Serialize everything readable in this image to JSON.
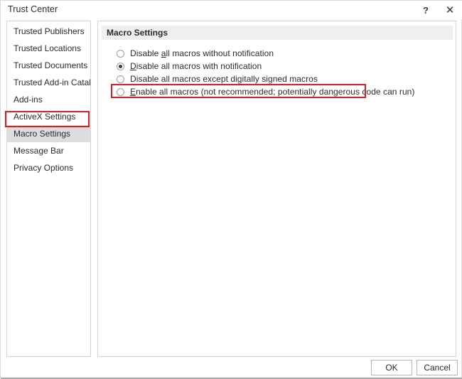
{
  "window": {
    "title": "Trust Center",
    "help_icon": "question-mark-icon",
    "help_label": "?",
    "close_icon": "close-icon",
    "close_label": "✕"
  },
  "sidebar": {
    "items": [
      {
        "label": "Trusted Publishers",
        "selected": false
      },
      {
        "label": "Trusted Locations",
        "selected": false
      },
      {
        "label": "Trusted Documents",
        "selected": false
      },
      {
        "label": "Trusted Add-in Catalogs",
        "selected": false
      },
      {
        "label": "Add-ins",
        "selected": false
      },
      {
        "label": "ActiveX Settings",
        "selected": false
      },
      {
        "label": "Macro Settings",
        "selected": true
      },
      {
        "label": "Message Bar",
        "selected": false
      },
      {
        "label": "Privacy Options",
        "selected": false
      }
    ]
  },
  "main": {
    "group_title": "Macro Settings",
    "options": [
      {
        "accel": "",
        "pre": "Disable ",
        "key": "a",
        "post": "ll macros without notification",
        "full": "Disable all macros without notification",
        "checked": false
      },
      {
        "pre": "",
        "key": "D",
        "post": "isable all macros with notification",
        "full": "Disable all macros with notification",
        "checked": true
      },
      {
        "pre": "Disable all macros except digitally signed macros",
        "key": "",
        "post": "",
        "full": "Disable all macros except digitally signed macros",
        "checked": false
      },
      {
        "pre": "",
        "key": "E",
        "post": "nable all macros (not recommended; potentially dangerous code can run)",
        "full": "Enable all macros (not recommended; potentially dangerous code can run)",
        "checked": false
      }
    ]
  },
  "footer": {
    "ok_label": "OK",
    "cancel_label": "Cancel"
  },
  "annotations": {
    "color": "#e01b1b",
    "targets": [
      "sidebar-item-macro-settings",
      "radio-enable-all-macros"
    ]
  }
}
